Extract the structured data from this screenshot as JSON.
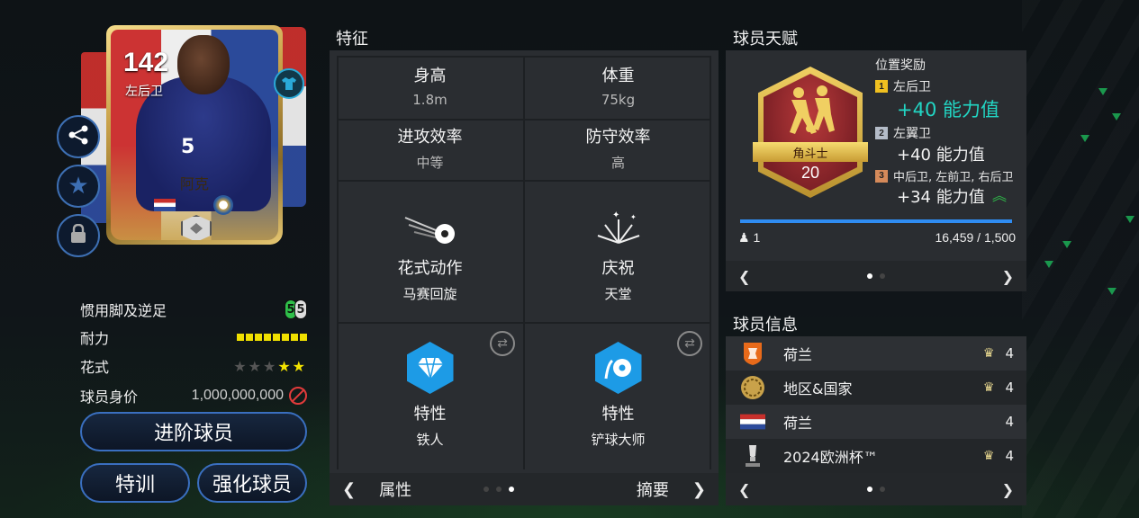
{
  "player": {
    "rating": "142",
    "position": "左后卫",
    "name": "阿克",
    "jersey_number": "5"
  },
  "left_stats": {
    "weak_foot_label": "惯用脚及逆足",
    "weak_foot_left": "5",
    "weak_foot_right": "5",
    "stamina_label": "耐力",
    "skills_label": "花式",
    "skill_stars_filled": 2,
    "skill_stars_total": 5,
    "value_label": "球员身价",
    "value": "1,000,000,000"
  },
  "buttons": {
    "advance": "进阶球员",
    "train": "特训",
    "boost": "强化球员"
  },
  "features": {
    "title": "特征",
    "height_label": "身高",
    "height_value": "1.8m",
    "weight_label": "体重",
    "weight_value": "75kg",
    "attack_label": "进攻效率",
    "attack_value": "中等",
    "defense_label": "防守效率",
    "defense_value": "高",
    "skill_move_label": "花式动作",
    "skill_move_value": "马赛回旋",
    "celebration_label": "庆祝",
    "celebration_value": "天堂",
    "trait1_label": "特性",
    "trait1_value": "铁人",
    "trait2_label": "特性",
    "trait2_value": "铲球大师",
    "footer_left": "属性",
    "footer_right": "摘要"
  },
  "talent": {
    "title": "球员天赋",
    "badge_name": "角斗士",
    "badge_level": "20",
    "bonus_header": "位置奖励",
    "bonuses": [
      {
        "rank": "1",
        "positions": "左后卫",
        "value": "+40 能力值"
      },
      {
        "rank": "2",
        "positions": "左翼卫",
        "value": "+40 能力值"
      },
      {
        "rank": "3",
        "positions": "中后卫, 左前卫, 右后卫",
        "value": "+34 能力值"
      }
    ],
    "count": "1",
    "progress_text": "16,459 / 1,500",
    "progress_fraction": 1.0
  },
  "info": {
    "title": "球员信息",
    "rows": [
      {
        "text": "荷兰",
        "rating": "4"
      },
      {
        "text": "地区&国家",
        "rating": "4"
      },
      {
        "text": "荷兰",
        "rating": "4"
      },
      {
        "text": "2024欧洲杯™",
        "rating": "4"
      }
    ]
  },
  "nav": {
    "prev": "❮",
    "next": "❯"
  },
  "colors": {
    "accent_blue": "#3a6fc0",
    "highlight_teal": "#22d6c4",
    "stamina_yellow": "#f0e000",
    "gold": "#c9a24a"
  },
  "icons": {
    "share": "share-icon",
    "favorite": "star-icon",
    "lock": "lock-icon",
    "shirt": "shirt-icon"
  }
}
